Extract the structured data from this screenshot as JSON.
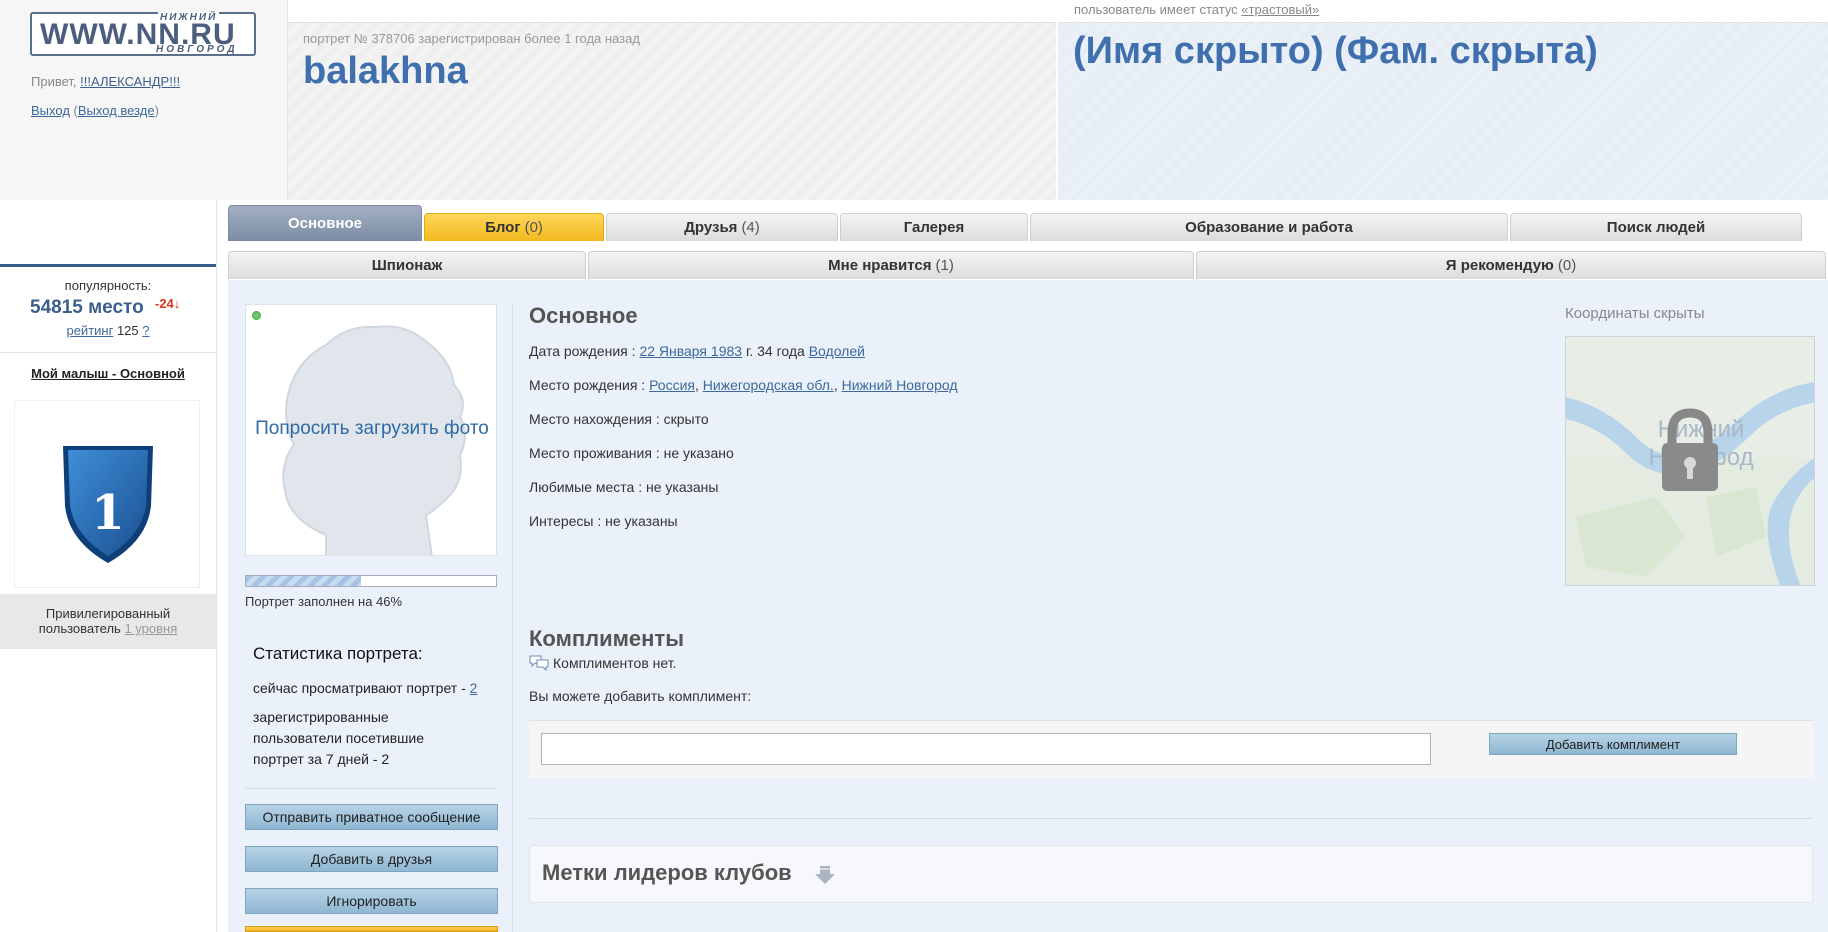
{
  "site": {
    "logo_main": "WWW.NN.RU",
    "logo_top": "НИЖНИЙ",
    "logo_bottom": "НОВГОРОД",
    "greeting_prefix": "Привет,",
    "user_name": "!!!АЛЕКСАНДР!!!",
    "logout": "Выход",
    "logout_all": "Выход везде"
  },
  "header": {
    "trust_prefix": "пользователь имеет статус",
    "trust_link": "«трастовый»",
    "reg_info": "портрет № 378706 зарегистрирован более 1 года назад",
    "nickname": "balakhna",
    "full_name": "(Имя скрыто) (Фам. скрыта)"
  },
  "sidebar": {
    "popularity_label": "популярность:",
    "place": "54815 место",
    "place_delta": "-24↓",
    "rating_link": "рейтинг",
    "rating_value": "125",
    "rating_help": "?",
    "baby_title": "Мой малыш - Основной",
    "badge_number": "1",
    "priv_line1": "Привилегированный",
    "priv_line2": "пользователь",
    "priv_level": "1 уровня"
  },
  "tabs_row1": [
    {
      "label": "Основное",
      "count": ""
    },
    {
      "label": "Блог",
      "count": "(0)"
    },
    {
      "label": "Друзья",
      "count": "(4)"
    },
    {
      "label": "Галерея",
      "count": ""
    },
    {
      "label": "Образование и работа",
      "count": ""
    },
    {
      "label": "Поиск людей",
      "count": ""
    }
  ],
  "tabs_row2": [
    {
      "label": "Шпионаж",
      "count": ""
    },
    {
      "label": "Мне нравится",
      "count": "(1)"
    },
    {
      "label": "Я рекомендую",
      "count": "(0)"
    }
  ],
  "profile": {
    "photo_request": "Попросить загрузить фото",
    "fill_percent": 46,
    "fill_text": "Портрет заполнен на 46%",
    "stats_title": "Статистика портрета:",
    "now_viewing_prefix": "сейчас просматривают портрет -",
    "now_viewing_count": "2",
    "visits_text": "зарегистрированные пользователи посетившие портрет за 7 дней - 2",
    "btn_message": "Отправить приватное сообщение",
    "btn_add_friend": "Добавить в друзья",
    "btn_ignore": "Игнорировать"
  },
  "main_info": {
    "title": "Основное",
    "birth_label": "Дата рождения :",
    "birth_date": "22 Января 1983",
    "birth_age": "г. 34 года",
    "zodiac": "Водолей",
    "birthplace_label": "Место рождения :",
    "birthplace_country": "Россия",
    "birthplace_region": "Нижегородская обл.",
    "birthplace_city": "Нижний Новгород",
    "location": "Место нахождения : скрыто",
    "residence": "Место проживания : не указано",
    "fav_places": "Любимые места : не указаны",
    "interests": "Интересы : не указаны",
    "coords": "Координаты скрыты",
    "map_city_line1": "Нижний",
    "map_city_line2": "Новгород"
  },
  "compliments": {
    "title": "Комплименты",
    "empty": "Комплиментов нет.",
    "hint": "Вы можете добавить комплимент:",
    "input_value": "",
    "add_button": "Добавить комплимент"
  },
  "clubs": {
    "title": "Метки лидеров клубов"
  },
  "colors": {
    "accent_blue": "#3f6fae",
    "tab_active": "#8f9db3",
    "tab_blog": "#f5c232",
    "button_blue": "#9fc2dc",
    "content_bg": "#eaf1fa"
  }
}
